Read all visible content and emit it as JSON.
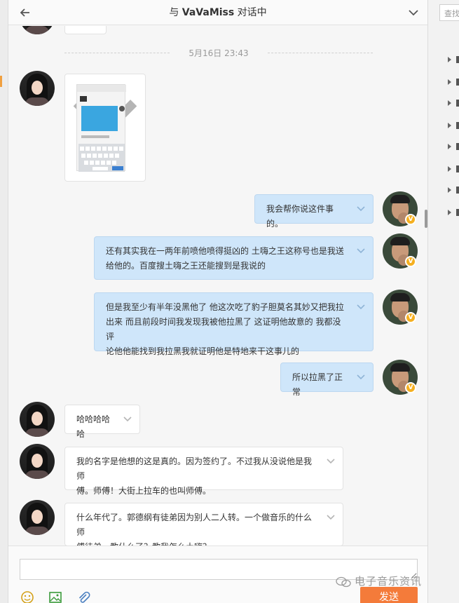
{
  "header": {
    "title_prefix": "与 ",
    "contact_name": "VaVaMiss",
    "title_suffix": " 对话中"
  },
  "timestamp": "5月16日 23:43",
  "messages": [
    {
      "from": "her",
      "type": "image"
    },
    {
      "from": "me",
      "text": "我会帮你说这件事的。"
    },
    {
      "from": "me",
      "line1": "还有其实我在一两年前喷他喷得挺凶的 土嗨之王这称号也是我送",
      "line2": "给他的。百度搜土嗨之王还能搜到是我说的"
    },
    {
      "from": "me",
      "line1": "但是我至少有半年没黑他了 他这次吃了豹子胆莫名其妙又把我拉",
      "line2": "出来 而且前段时间我发现我被他拉黑了 这证明他故意的 我都没评",
      "line3": "论他他能找到我拉黑我就证明他是特地来干这事儿的"
    },
    {
      "from": "me",
      "text": "所以拉黑了正常"
    },
    {
      "from": "her",
      "text": "哈哈哈哈哈"
    },
    {
      "from": "her",
      "line1": "我的名字是他想的这是真的。因为签约了。不过我从没说他是我师",
      "line2": "傅。师傅！大街上拉车的也叫师傅。"
    },
    {
      "from": "her",
      "line1": "什么年代了。郭德纲有徒弟因为别人二人转。一个做音乐的什么师",
      "line2": "傅徒弟，教什么了？教我怎么土嗨？"
    }
  ],
  "input": {
    "value": "",
    "placeholder": ""
  },
  "toolbar": {
    "send_label": "发送"
  },
  "right_panel": {
    "search_placeholder": "查找"
  },
  "watermark": "电子音乐资讯",
  "colors": {
    "accent": "#f47b3a",
    "outgoing_bubble": "#cfe6fa",
    "badge": "#f5b020"
  },
  "icons": [
    "back-arrow-icon",
    "chevron-down-icon",
    "emoji-icon",
    "image-icon",
    "attach-icon",
    "wechat-icon"
  ]
}
